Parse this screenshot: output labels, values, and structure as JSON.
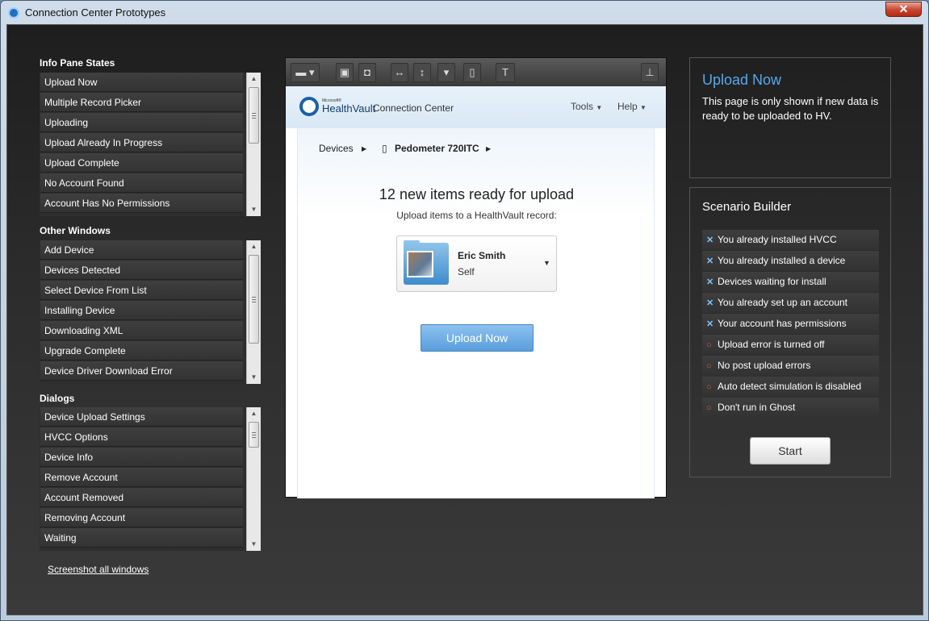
{
  "window": {
    "title": "Connection Center Prototypes",
    "close": "✕"
  },
  "info_pane": {
    "title": "Info Pane States",
    "items": [
      "Upload Now",
      "Multiple Record Picker",
      "Uploading",
      "Upload Already In Progress",
      "Upload Complete",
      "No Account Found",
      "Account Has No Permissions"
    ]
  },
  "other_windows": {
    "title": "Other Windows",
    "items": [
      "Add Device",
      "Devices Detected",
      "Select Device From List",
      "Installing Device",
      "Downloading XML",
      "Upgrade Complete",
      "Device Driver Download Error"
    ]
  },
  "dialogs": {
    "title": "Dialogs",
    "items": [
      "Device Upload Settings",
      "HVCC Options",
      "Device Info",
      "Remove Account",
      "Account Removed",
      "Removing Account",
      "Waiting"
    ]
  },
  "screenshot_link": "Screenshot all windows",
  "preview": {
    "logo_ms": "Microsoft®",
    "logo_hv": "HealthVault",
    "logo_cc": "Connection Center",
    "menu_tools": "Tools",
    "menu_help": "Help",
    "crumb_devices": "Devices",
    "crumb_device": "Pedometer 720ITC",
    "headline": "12 new items ready for upload",
    "subline": "Upload items to a HealthVault record:",
    "record_name": "Eric Smith",
    "record_relation": "Self",
    "upload_button": "Upload Now"
  },
  "info_box": {
    "title": "Upload Now",
    "text": "This page is only shown if new data is ready to be uploaded to HV."
  },
  "scenario": {
    "title": "Scenario Builder",
    "items": [
      {
        "label": "You already installed HVCC",
        "state": "on"
      },
      {
        "label": "You already installed a device",
        "state": "on"
      },
      {
        "label": "Devices waiting for install",
        "state": "on"
      },
      {
        "label": "You already set up an account",
        "state": "on"
      },
      {
        "label": "Your account has permissions",
        "state": "on"
      },
      {
        "label": "Upload error is turned off",
        "state": "off"
      },
      {
        "label": "No post upload errors",
        "state": "off"
      },
      {
        "label": "Auto detect simulation is disabled",
        "state": "off"
      },
      {
        "label": "Don't run in Ghost",
        "state": "off"
      }
    ],
    "start_button": "Start"
  },
  "colors": {
    "accent": "#56a9ee",
    "on_icon": "#7fc4ff",
    "off_icon": "#e05a4a"
  }
}
